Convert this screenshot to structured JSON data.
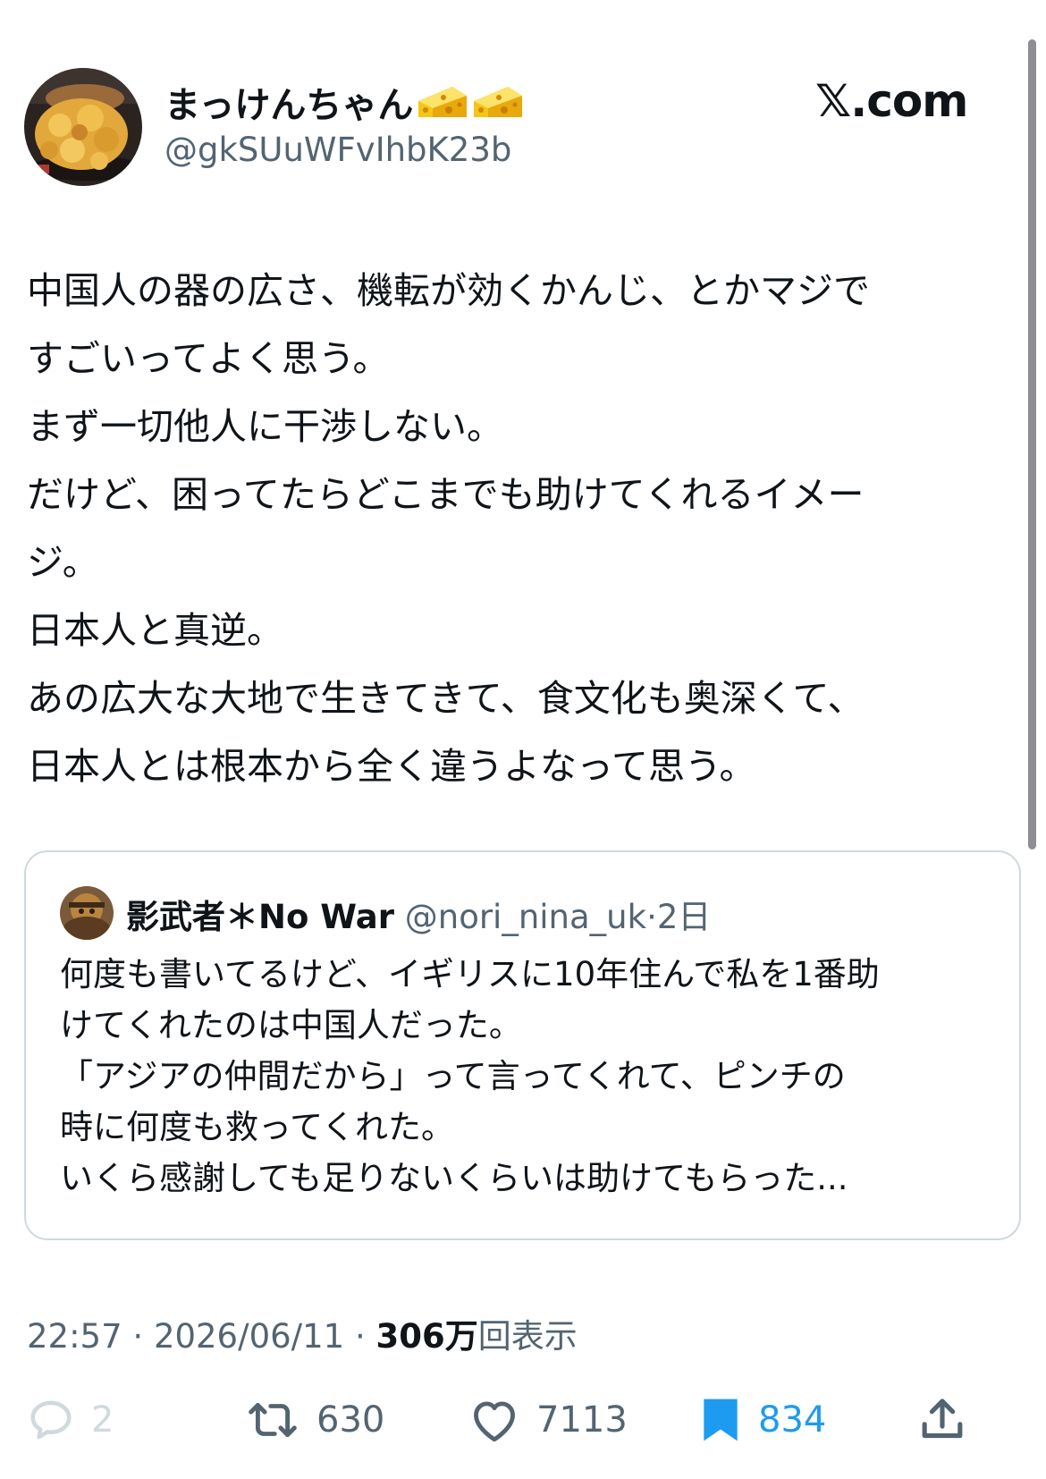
{
  "author": {
    "display_name": "まっけんちゃん",
    "handle": "@gkSUuWFvIhbK23b",
    "name_emojis": [
      "cheese-emoji",
      "cheese-emoji"
    ]
  },
  "brand": "𝕏.com",
  "tweet": {
    "lines": [
      "中国人の器の広さ、機転が効くかんじ、とかマジで",
      "すごいってよく思う。",
      "まず一切他人に干渉しない。",
      "だけど、困ってたらどこまでも助けてくれるイメー",
      "ジ。",
      "日本人と真逆。",
      "あの広大な大地で生きてきて、食文化も奥深くて、",
      "日本人とは根本から全く違うよなって思う。"
    ]
  },
  "quote": {
    "display_name": "影武者＊No War",
    "handle": "@nori_nina_uk",
    "separator": "·",
    "time": "2日",
    "lines": [
      "何度も書いてるけど、イギリスに10年住んで私を1番助",
      "けてくれたのは中国人だった。",
      "「アジアの仲間だから」って言ってくれて、ピンチの",
      "時に何度も救ってくれた。",
      "いくら感謝しても足りないくらいは助けてもらった..."
    ]
  },
  "meta": {
    "time": "22:57",
    "sep1": " · ",
    "date": "2026/06/11",
    "sep2": " · ",
    "views_count": "306万",
    "views_label": "回表示"
  },
  "actions": {
    "reply_count": "2",
    "retweet_count": "630",
    "like_count": "7113",
    "bookmark_count": "834"
  },
  "colors": {
    "text": "#0f1419",
    "secondary": "#536471",
    "accent": "#1d9bf0",
    "border": "#cfd9de",
    "faded": "#cfd9de"
  },
  "icons": [
    "reply-icon",
    "retweet-icon",
    "like-icon",
    "bookmark-icon",
    "share-icon"
  ]
}
